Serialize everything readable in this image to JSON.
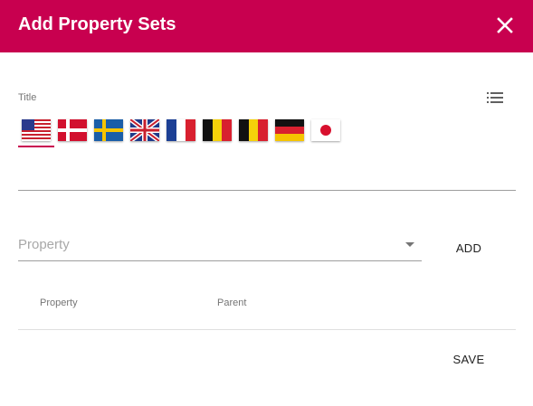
{
  "dialog": {
    "title": "Add Property Sets",
    "close_icon": "close-icon"
  },
  "title_field": {
    "label": "Title",
    "value": "",
    "list_icon": "list-icon",
    "active_language": "us"
  },
  "languages": [
    {
      "code": "us",
      "icon": "us-flag-icon"
    },
    {
      "code": "dk",
      "icon": "denmark-flag-icon"
    },
    {
      "code": "se",
      "icon": "sweden-flag-icon"
    },
    {
      "code": "gb",
      "icon": "uk-flag-icon"
    },
    {
      "code": "fr",
      "icon": "france-flag-icon"
    },
    {
      "code": "be",
      "icon": "belgium-flag-icon"
    },
    {
      "code": "be2",
      "icon": "belgium-flag-icon"
    },
    {
      "code": "de",
      "icon": "germany-flag-icon"
    },
    {
      "code": "jp",
      "icon": "japan-flag-icon"
    }
  ],
  "property_select": {
    "placeholder": "Property",
    "add_label": "ADD"
  },
  "table": {
    "columns": [
      "Property",
      "Parent"
    ],
    "rows": []
  },
  "footer": {
    "save_label": "SAVE"
  },
  "colors": {
    "accent": "#c8004f",
    "header_text": "#ffffff"
  }
}
